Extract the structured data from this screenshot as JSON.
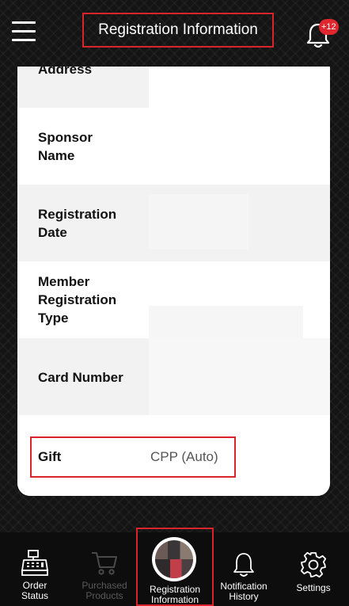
{
  "header": {
    "title": "Registration Information",
    "notification_count": "+12",
    "icons": {
      "menu": "hamburger-menu-icon",
      "notifications": "bell-icon"
    }
  },
  "fields": [
    {
      "label": "Address",
      "value": ""
    },
    {
      "label": "Sponsor\nName",
      "value": ""
    },
    {
      "label": "Registration\nDate",
      "value": ""
    },
    {
      "label": "Member\nRegistration\nType",
      "value": ""
    },
    {
      "label": "Card Number",
      "value": ""
    }
  ],
  "gift": {
    "label": "Gift",
    "value": "CPP (Auto)"
  },
  "bottom_nav": [
    {
      "label": "Order\nStatus",
      "icon": "cash-register-icon",
      "enabled": true
    },
    {
      "label": "Purchased\nProducts",
      "icon": "shopping-cart-icon",
      "enabled": false
    },
    {
      "label": "Registration\nInformation",
      "icon": "avatar",
      "enabled": true,
      "active": true
    },
    {
      "label": "Notification\nHistory",
      "icon": "bell-icon",
      "enabled": true
    },
    {
      "label": "Settings",
      "icon": "gear-icon",
      "enabled": true
    }
  ],
  "colors": {
    "highlight": "#d9242b",
    "badge": "#e0262e",
    "background": "#141414"
  }
}
